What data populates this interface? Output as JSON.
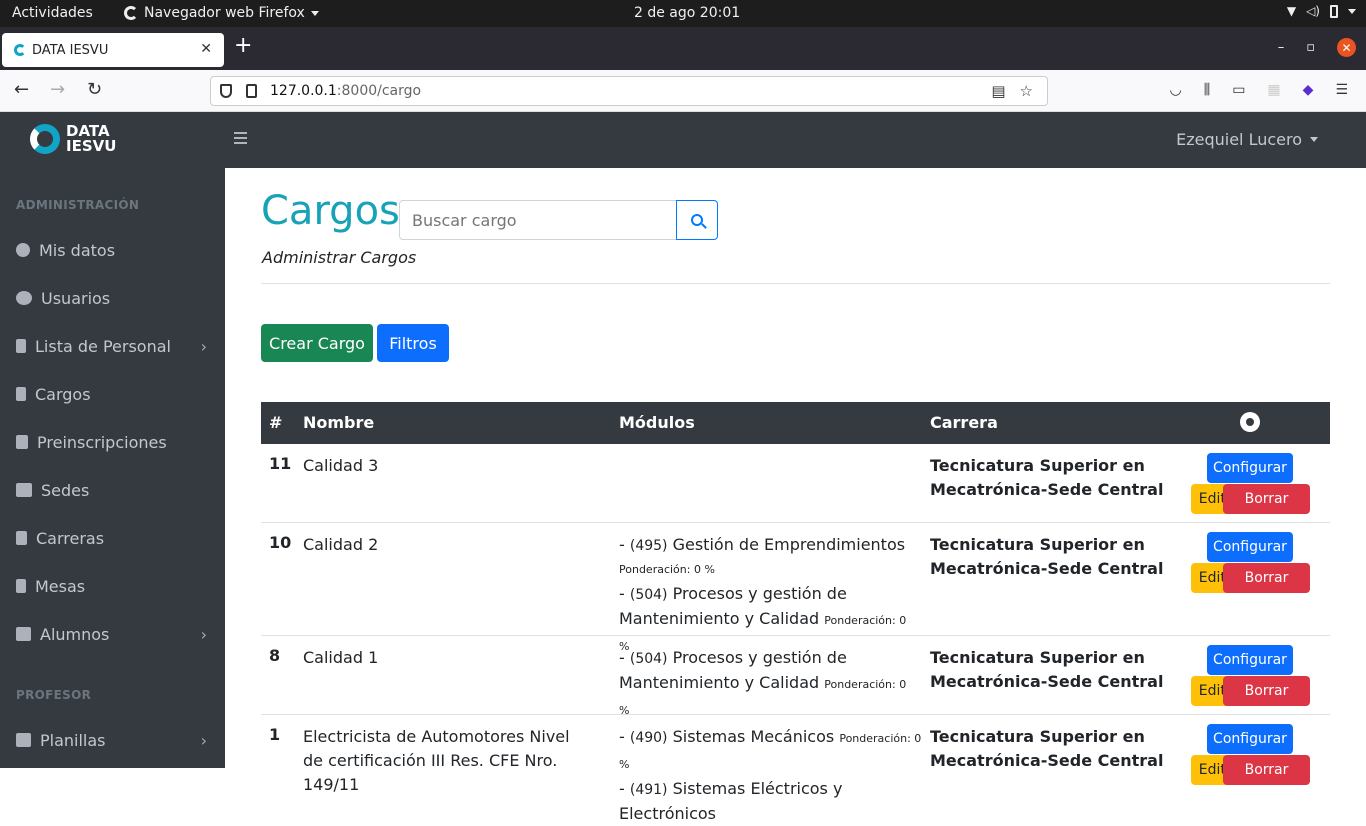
{
  "system_bar": {
    "activities": "Actividades",
    "app_menu": "Navegador web Firefox",
    "clock": "2 de ago  20:01"
  },
  "browser": {
    "tab_title": "DATA IESVU",
    "url_host": "127.0.0.1",
    "url_path": ":8000/cargo"
  },
  "sidebar": {
    "brand_line1": "DATA",
    "brand_line2": "IESVU",
    "header_admin": "ADMINISTRACIÓN",
    "header_profesor": "PROFESOR",
    "items": [
      {
        "label": "Mis datos"
      },
      {
        "label": "Usuarios"
      },
      {
        "label": "Lista de Personal"
      },
      {
        "label": "Cargos"
      },
      {
        "label": "Preinscripciones"
      },
      {
        "label": "Sedes"
      },
      {
        "label": "Carreras"
      },
      {
        "label": "Mesas"
      },
      {
        "label": "Alumnos"
      },
      {
        "label": "Planillas"
      }
    ]
  },
  "header": {
    "user_name": "Ezequiel Lucero"
  },
  "page": {
    "title": "Cargos",
    "search_placeholder": "Buscar cargo",
    "subtitle": "Administrar Cargos",
    "btn_crear": "Crear Cargo",
    "btn_filtros": "Filtros"
  },
  "table": {
    "headers": [
      "#",
      "Nombre",
      "Módulos",
      "Carrera"
    ],
    "actions": {
      "configurar": "Configurar",
      "editar": "Editar",
      "borrar": "Borrar"
    },
    "rows": [
      {
        "id": "11",
        "nombre": "Calidad 3",
        "carrera": "Tecnicatura Superior en Mecatrónica-Sede Central",
        "modulos": []
      },
      {
        "id": "10",
        "nombre": "Calidad 2",
        "carrera": "Tecnicatura Superior en Mecatrónica-Sede Central",
        "modulos": [
          {
            "prefix": "- ",
            "code": "(495)",
            "name": " Gestión de Emprendimientos",
            "pond": "Ponderación: 0 %"
          },
          {
            "prefix": "- ",
            "code": "(504)",
            "name": " Procesos y gestión de Mantenimiento y Calidad",
            "pond": "Ponderación: 0 %"
          }
        ]
      },
      {
        "id": "8",
        "nombre": "Calidad 1",
        "carrera": "Tecnicatura Superior en Mecatrónica-Sede Central",
        "modulos": [
          {
            "prefix": "- ",
            "code": "(504)",
            "name": " Procesos y gestión de Mantenimiento y Calidad",
            "pond": "Ponderación: 0 %"
          }
        ]
      },
      {
        "id": "1",
        "nombre": "Electricista de Automotores Nivel de certificación III Res. CFE Nro. 149/11",
        "carrera": "Tecnicatura Superior en Mecatrónica-Sede Central",
        "modulos": [
          {
            "prefix": "- ",
            "code": "(490)",
            "name": " Sistemas Mecánicos",
            "pond": "Ponderación: 0 %"
          },
          {
            "prefix": "- ",
            "code": "(491)",
            "name": " Sistemas Eléctricos y Electrónicos",
            "pond": ""
          }
        ]
      }
    ]
  }
}
